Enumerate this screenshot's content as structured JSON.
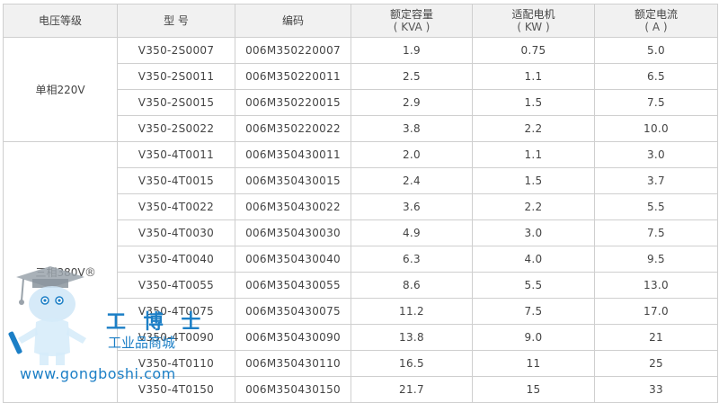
{
  "table": {
    "headers": [
      {
        "title": "电压等级",
        "unit": ""
      },
      {
        "title": "型 号",
        "unit": ""
      },
      {
        "title": "编码",
        "unit": ""
      },
      {
        "title": "额定容量",
        "unit": "( KVA )"
      },
      {
        "title": "适配电机",
        "unit": "( KW )"
      },
      {
        "title": "额定电流",
        "unit": "( A )"
      }
    ],
    "groups": [
      {
        "label": "单相220V",
        "rows": [
          {
            "model": "V350-2S0007",
            "code": "006M350220007",
            "capacity": "1.9",
            "motor": "0.75",
            "current": "5.0"
          },
          {
            "model": "V350-2S0011",
            "code": "006M350220011",
            "capacity": "2.5",
            "motor": "1.1",
            "current": "6.5"
          },
          {
            "model": "V350-2S0015",
            "code": "006M350220015",
            "capacity": "2.9",
            "motor": "1.5",
            "current": "7.5"
          },
          {
            "model": "V350-2S0022",
            "code": "006M350220022",
            "capacity": "3.8",
            "motor": "2.2",
            "current": "10.0"
          }
        ]
      },
      {
        "label": "三相380V",
        "rows": [
          {
            "model": "V350-4T0011",
            "code": "006M350430011",
            "capacity": "2.0",
            "motor": "1.1",
            "current": "3.0"
          },
          {
            "model": "V350-4T0015",
            "code": "006M350430015",
            "capacity": "2.4",
            "motor": "1.5",
            "current": "3.7"
          },
          {
            "model": "V350-4T0022",
            "code": "006M350430022",
            "capacity": "3.6",
            "motor": "2.2",
            "current": "5.5"
          },
          {
            "model": "V350-4T0030",
            "code": "006M350430030",
            "capacity": "4.9",
            "motor": "3.0",
            "current": "7.5"
          },
          {
            "model": "V350-4T0040",
            "code": "006M350430040",
            "capacity": "6.3",
            "motor": "4.0",
            "current": "9.5"
          },
          {
            "model": "V350-4T0055",
            "code": "006M350430055",
            "capacity": "8.6",
            "motor": "5.5",
            "current": "13.0"
          },
          {
            "model": "V350-4T0075",
            "code": "006M350430075",
            "capacity": "11.2",
            "motor": "7.5",
            "current": "17.0"
          },
          {
            "model": "V350-4T0090",
            "code": "006M350430090",
            "capacity": "13.8",
            "motor": "9.0",
            "current": "21"
          },
          {
            "model": "V350-4T0110",
            "code": "006M350430110",
            "capacity": "16.5",
            "motor": "11",
            "current": "25"
          },
          {
            "model": "V350-4T0150",
            "code": "006M350430150",
            "capacity": "21.7",
            "motor": "15",
            "current": "33"
          }
        ]
      }
    ]
  },
  "watermark": {
    "brand": "工 博 士",
    "tagline": "工业品商城",
    "url": "www.gongboshi.com",
    "registered": "®",
    "color": "#1c7fc6"
  }
}
